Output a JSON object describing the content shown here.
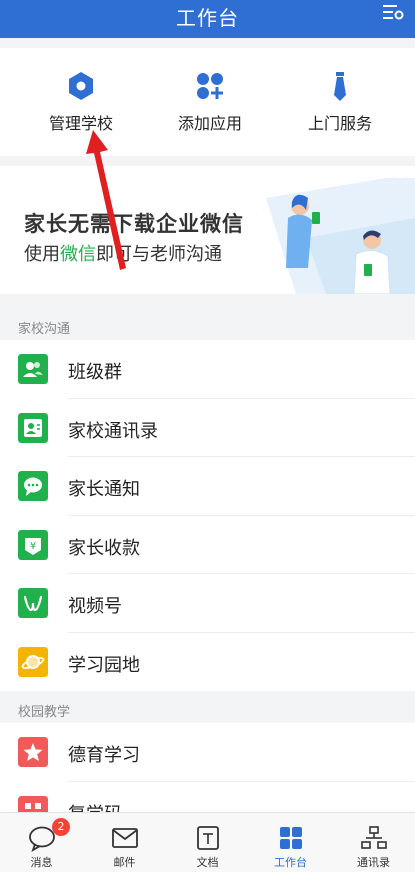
{
  "header": {
    "title": "工作台",
    "settings_icon": "settings-sliders-icon"
  },
  "quick_actions": [
    {
      "label": "管理学校",
      "icon": "hexagon-icon"
    },
    {
      "label": "添加应用",
      "icon": "add-apps-icon"
    },
    {
      "label": "上门服务",
      "icon": "tie-icon"
    }
  ],
  "banner": {
    "line1": "家长无需下载企业微信",
    "line2_prefix": "使用",
    "line2_highlight": "微信",
    "line2_suffix": "即可与老师沟通"
  },
  "sections": [
    {
      "title": "家校沟通",
      "items": [
        {
          "label": "班级群",
          "icon": "class-group-icon",
          "color": "#21b14c"
        },
        {
          "label": "家校通讯录",
          "icon": "contacts-card-icon",
          "color": "#21b14c"
        },
        {
          "label": "家长通知",
          "icon": "chat-bubble-icon",
          "color": "#21b14c"
        },
        {
          "label": "家长收款",
          "icon": "yuan-payment-icon",
          "color": "#21b14c"
        },
        {
          "label": "视频号",
          "icon": "video-channel-icon",
          "color": "#21b14c"
        },
        {
          "label": "学习园地",
          "icon": "planet-icon",
          "color": "#f5b400"
        }
      ]
    },
    {
      "title": "校园教学",
      "items": [
        {
          "label": "德育学习",
          "icon": "star-icon",
          "color": "#f25a5a"
        },
        {
          "label": "复学码",
          "icon": "qr-code-icon",
          "color": "#f25a5a"
        }
      ]
    }
  ],
  "tabbar": {
    "items": [
      {
        "label": "消息",
        "icon": "message-icon",
        "badge": "2",
        "active": false
      },
      {
        "label": "邮件",
        "icon": "mail-icon",
        "active": false
      },
      {
        "label": "文档",
        "icon": "document-icon",
        "active": false
      },
      {
        "label": "工作台",
        "icon": "workbench-icon",
        "active": true
      },
      {
        "label": "通讯录",
        "icon": "contacts-icon",
        "active": false
      }
    ]
  },
  "colors": {
    "brand": "#2f6fd4",
    "green": "#21b14c",
    "annotation_arrow": "#e02020"
  }
}
